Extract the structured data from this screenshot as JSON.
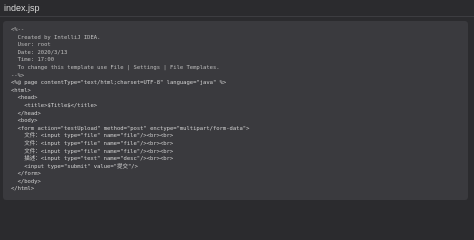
{
  "file": {
    "title": "index.jsp"
  },
  "code": {
    "lines": [
      "<%--",
      "  Created by IntelliJ IDEA.",
      "  User: root",
      "  Date: 2020/3/13",
      "  Time: 17:00",
      "  To change this template use File | Settings | File Templates.",
      "--%>",
      "<%@ page contentType=\"text/html;charset=UTF-8\" language=\"java\" %>",
      "<html>",
      "  <head>",
      "    <title>$Title$</title>",
      "  </head>",
      "  <body>",
      "  <form action=\"testUpload\" method=\"post\" enctype=\"multipart/form-data\">",
      "    文件：<input type=\"file\" name=\"file\"/><br><br>",
      "    文件：<input type=\"file\" name=\"file\"/><br><br>",
      "    文件：<input type=\"file\" name=\"file\"/><br><br>",
      "    描述：<input type=\"text\" name=\"desc\"/><br><br>",
      "    <input type=\"submit\" value=\"提交\"/>",
      "  </form>",
      "  </body>",
      "</html>"
    ]
  }
}
